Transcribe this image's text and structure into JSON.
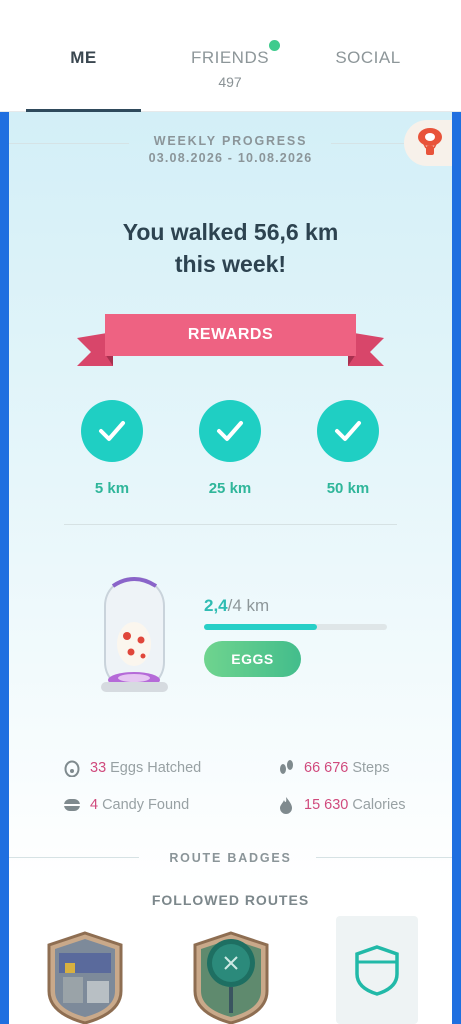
{
  "tabs": [
    {
      "label": "ME",
      "sub": ""
    },
    {
      "label": "FRIENDS",
      "sub": "497"
    },
    {
      "label": "SOCIAL",
      "sub": ""
    }
  ],
  "weekly": {
    "title": "WEEKLY PROGRESS",
    "dates": "03.08.2026 - 10.08.2026",
    "headline_line1": "You walked 56,6 km",
    "headline_line2": "this week!"
  },
  "rewards": {
    "label": "REWARDS",
    "milestones": [
      {
        "label": "5 km",
        "done": true
      },
      {
        "label": "25 km",
        "done": true
      },
      {
        "label": "50 km",
        "done": true
      }
    ]
  },
  "egg": {
    "current": "2,4",
    "total": "/4 km",
    "progress_fraction": 0.62,
    "button_label": "EGGS"
  },
  "stats": {
    "eggs_hatched": {
      "num": "33",
      "label": "Eggs Hatched"
    },
    "steps": {
      "num": "66 676",
      "label": "Steps"
    },
    "candy": {
      "num": "4",
      "label": "Candy Found"
    },
    "calories": {
      "num": "15 630",
      "label": "Calories"
    }
  },
  "route_badges_title": "ROUTE BADGES",
  "followed_routes_title": "FOLLOWED ROUTES",
  "colors": {
    "accent_teal": "#1fcfc3",
    "ribbon_pink": "#ec5a7a",
    "stat_number": "#d04a7d",
    "frame_blue": "#1f6fe0",
    "friends_dot": "#3fcb8d"
  }
}
